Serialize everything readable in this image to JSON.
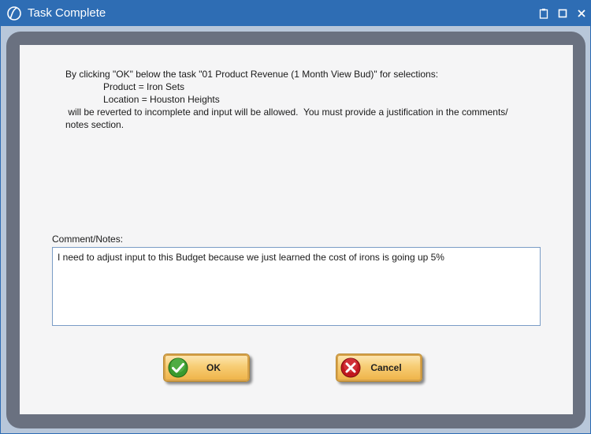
{
  "window": {
    "title": "Task Complete"
  },
  "message": {
    "line1": "By clicking \"OK\" below the task \"01 Product Revenue (1 Month View Bud)\" for selections:",
    "line2": "Product = Iron Sets",
    "line3": "Location = Houston Heights",
    "line4": " will be reverted to incomplete and input will be allowed.  You must provide a justification in the comments/",
    "line5": "notes section."
  },
  "comments": {
    "label": "Comment/Notes:",
    "value": "I need to adjust input to this Budget because we just learned the cost of irons is going up 5%"
  },
  "buttons": {
    "ok_label": "OK",
    "cancel_label": "Cancel"
  },
  "colors": {
    "titlebar": "#2e6db4",
    "ok_icon": "#3a9a2e",
    "cancel_icon": "#c0171e",
    "button_gold": "#f7cd74"
  },
  "icons": {
    "app": "app-logo-icon",
    "titlebar_left": "clipboard-icon",
    "titlebar_right": "maximize-icon",
    "titlebar_close": "close-icon",
    "ok": "checkmark-icon",
    "cancel": "x-icon"
  }
}
